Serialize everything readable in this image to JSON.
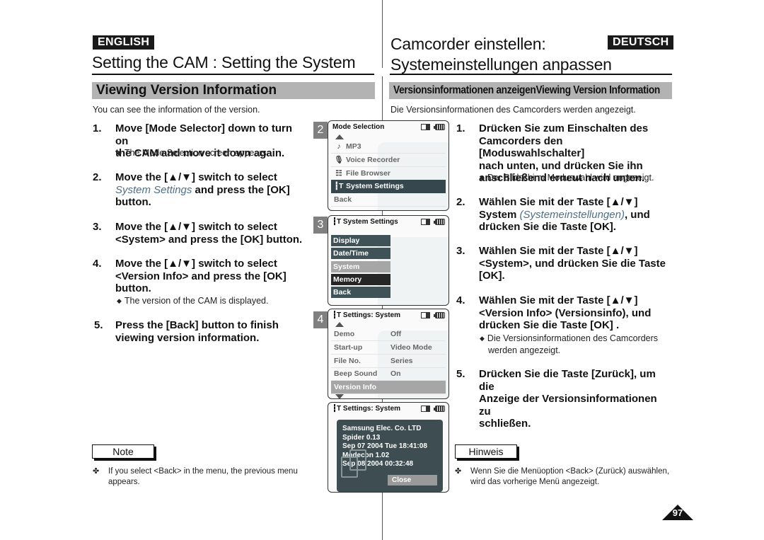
{
  "english": {
    "lang_badge": "ENGLISH",
    "title": "Setting the CAM : Setting the System",
    "section": "Viewing Version Information",
    "intro": "You can see the information of the version.",
    "steps": [
      {
        "num": "1.",
        "lines": [
          "Move [Mode Selector] down to turn on",
          "the CAM and move it down again."
        ],
        "sub": "The Mode Selection screen appears."
      },
      {
        "num": "2.",
        "line1": "Move the [▲/▼] switch to select",
        "italic": "System Settings",
        "line2_rest": " and press the [OK]",
        "line3": "button."
      },
      {
        "num": "3.",
        "lines": [
          "Move the [▲/▼] switch to select",
          "<System> and press the [OK] button."
        ]
      },
      {
        "num": "4.",
        "lines": [
          "Move the [▲/▼] switch to select",
          "<Version Info> and press the [OK]",
          "button."
        ],
        "sub": "The version of the CAM is displayed."
      },
      {
        "num": "5.",
        "lines": [
          "Press the [Back] button to finish",
          "viewing version information."
        ]
      }
    ],
    "note": {
      "label": "Note",
      "lines": [
        "If you select <Back> in the menu, the previous menu",
        "appears."
      ]
    }
  },
  "deutsch": {
    "lang_badge": "DEUTSCH",
    "title_line1": "Camcorder einstellen:",
    "title_line2": "Systemeinstellungen anpassen",
    "section": "Versionsinformationen anzeigenViewing Version Information",
    "intro": "Die Versionsinformationen des Camcorders werden angezeigt.",
    "steps": [
      {
        "num": "1.",
        "lines": [
          "Drücken Sie zum Einschalten des",
          "Camcorders den [Moduswahlschalter]",
          "nach unten, und drücken Sie ihn",
          "anschließend erneut nach unten."
        ],
        "sub": "Der Bildschirm Moduswahl wird angezeigt."
      },
      {
        "num": "2.",
        "line1": "Wählen Sie mit der Taste [▲/▼]",
        "line2_pre": "System ",
        "italic": "(Systemeinstellungen)",
        "line2_rest": ", und",
        "line3": "drücken Sie die Taste [OK]."
      },
      {
        "num": "3.",
        "lines": [
          "Wählen Sie mit der Taste [▲/▼]",
          "<System>, und drücken Sie die Taste",
          "[OK]."
        ]
      },
      {
        "num": "4.",
        "lines": [
          "Wählen Sie mit der Taste [▲/▼]",
          "<Version Info> (Versionsinfo), und",
          "drücken Sie die Taste [OK] ."
        ],
        "sub_lines": [
          "Die Versionsinformationen des Camcorders",
          "werden angezeigt."
        ]
      },
      {
        "num": "5.",
        "lines": [
          "Drücken Sie die Taste [Zurück], um die",
          "Anzeige der Versionsinformationen zu",
          "schließen."
        ]
      }
    ],
    "note": {
      "label": "Hinweis",
      "lines": [
        "Wenn Sie die Menüoption <Back> (Zurück) auswählen,",
        "wird das vorherige Menü angezeigt."
      ]
    }
  },
  "screens": [
    {
      "num": "2",
      "header": "Mode Selection",
      "items": [
        {
          "icon": "music-note-icon",
          "glyph": "♪",
          "label": "MP3"
        },
        {
          "icon": "microphone-icon",
          "glyph": "☰",
          "label": "Voice Recorder"
        },
        {
          "icon": "file-icon",
          "glyph": "☷",
          "label": "File Browser"
        },
        {
          "icon": "settings-icon",
          "glyph": "↕",
          "label": "System Settings",
          "selected": true
        },
        {
          "label": "Back"
        }
      ]
    },
    {
      "num": "3",
      "header": "System Settings",
      "items": [
        {
          "label": "Display"
        },
        {
          "label": "Date/Time"
        },
        {
          "label": "System",
          "state": "highlighted"
        },
        {
          "label": "Memory",
          "state": "focused"
        },
        {
          "label": "Back"
        }
      ]
    },
    {
      "num": "4",
      "header": "Settings: System",
      "items": [
        {
          "label": "Demo",
          "value": "Off"
        },
        {
          "label": "Start-up",
          "value": "Video Mode"
        },
        {
          "label": "File No.",
          "value": "Series"
        },
        {
          "label": "Beep Sound",
          "value": "On"
        },
        {
          "label": "Version Info",
          "value": "",
          "selected": true
        }
      ]
    },
    {
      "header": "Settings: System",
      "popup_lines": [
        "Samsung Elec. Co. LTD",
        "Spider 0.13",
        "Sep 07 2004 Tue 18:41:08",
        "Modecon 1.02",
        "Sep 08 2004 00:32:48"
      ],
      "close_label": "Close"
    }
  ],
  "page_number": "97"
}
